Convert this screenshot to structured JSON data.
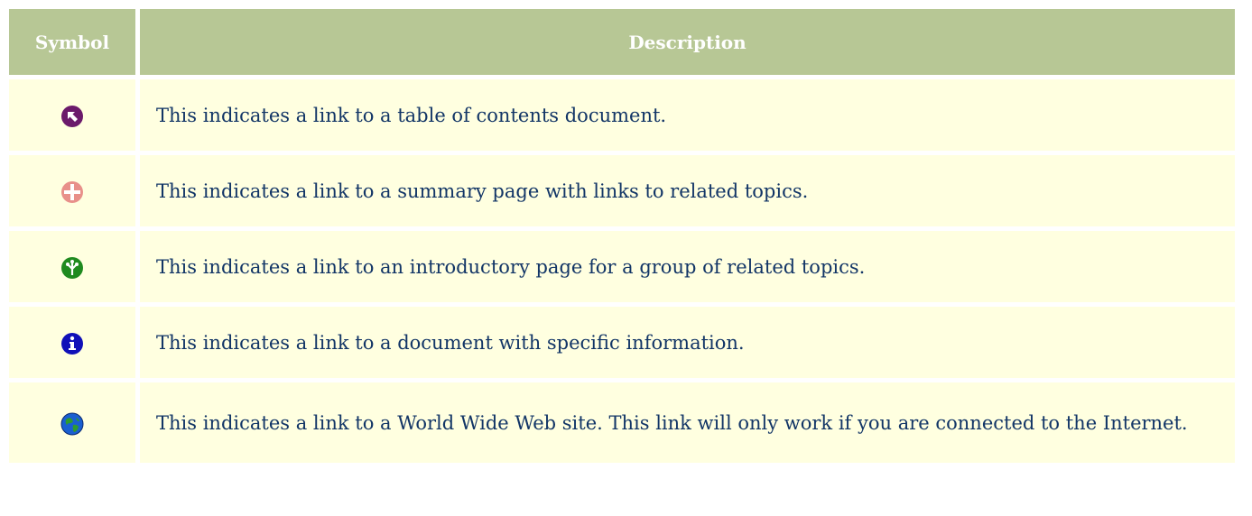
{
  "header": {
    "symbol": "Symbol",
    "description": "Description"
  },
  "rows": [
    {
      "icon": "toc-arrow-icon",
      "color": "#6b1a6b",
      "description": "This indicates a link to a table of contents document."
    },
    {
      "icon": "summary-cross-icon",
      "color": "#e8908a",
      "description": "This indicates a link to a summary page with links to related topics."
    },
    {
      "icon": "intro-tree-icon",
      "color": "#1f8a1f",
      "description": "This indicates a link to an introductory page for a group of related topics."
    },
    {
      "icon": "info-icon",
      "color": "#1010b8",
      "description": "This indicates a link to a document with specific information."
    },
    {
      "icon": "globe-icon",
      "color": "#1a5fd0",
      "description": "This indicates a link to a World Wide Web site.  This link will only work if you are connected to the Internet."
    }
  ],
  "colors": {
    "header_bg": "#b7c795",
    "row_bg": "#ffffe0",
    "text": "#123566"
  }
}
